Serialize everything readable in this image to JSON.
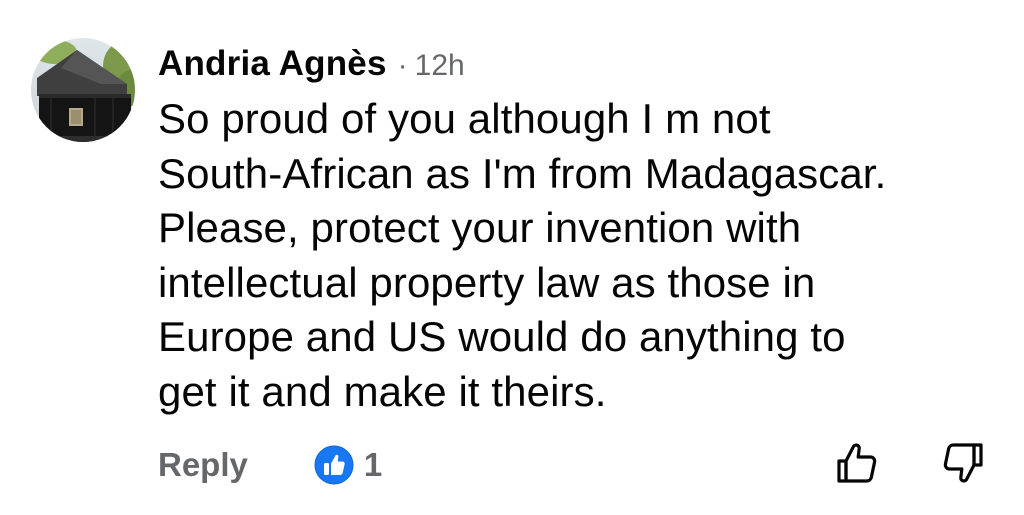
{
  "comment": {
    "author": "Andria Agnès",
    "separator": "·",
    "time": "12h",
    "text": "So proud of you although I m not\nSouth-African as I'm from Madagascar.\nPlease, protect your invention with\nintellectual property law  as those in\nEurope and US would do anything to\nget it and make it theirs.",
    "avatar_icon": "house-photo-avatar"
  },
  "actions": {
    "reply_label": "Reply",
    "reaction_icon": "like-badge-icon",
    "reaction_count": "1",
    "upvote_icon": "thumbs-up-outline-icon",
    "downvote_icon": "thumbs-down-outline-icon"
  },
  "colors": {
    "text": "#050505",
    "secondary": "#65676b",
    "like_blue": "#1877f2",
    "background": "#ffffff"
  }
}
